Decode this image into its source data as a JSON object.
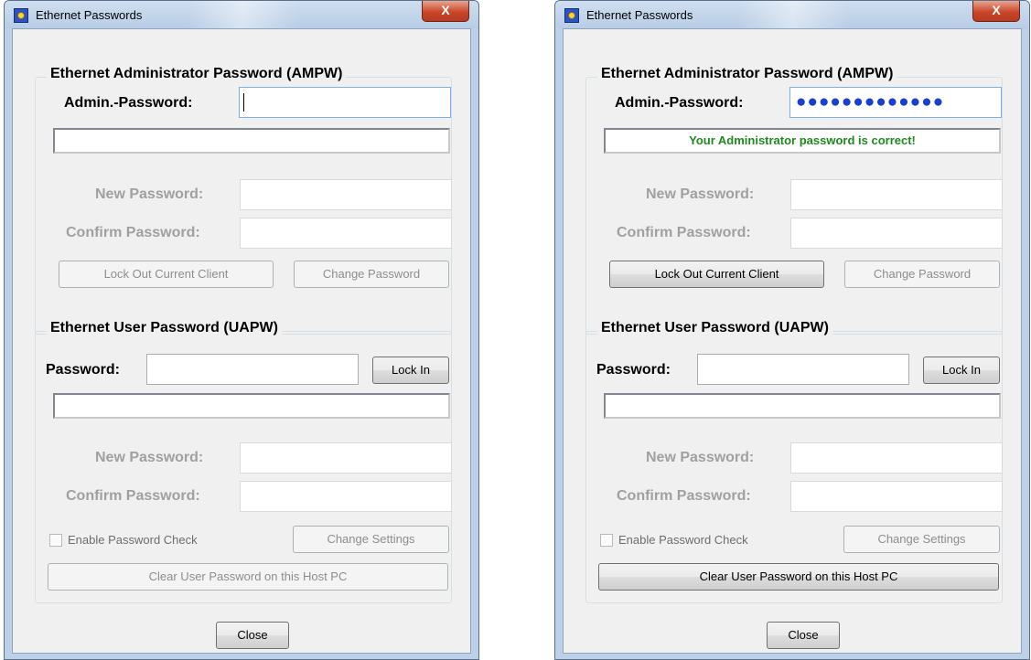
{
  "windows": [
    {
      "title": "Ethernet Passwords",
      "close_glyph": "X",
      "ampw": {
        "group_title": "Ethernet Administrator Password (AMPW)",
        "admin_label": "Admin.-Password:",
        "admin_value": "",
        "status_message": "",
        "new_password_label": "New Password:",
        "confirm_password_label": "Confirm Password:",
        "lock_out_button": "Lock Out Current Client",
        "change_password_button": "Change Password"
      },
      "uapw": {
        "group_title": "Ethernet User Password (UAPW)",
        "password_label": "Password:",
        "lock_in_button": "Lock In",
        "status_message": "",
        "new_password_label": "New Password:",
        "confirm_password_label": "Confirm Password:",
        "enable_check_label": "Enable Password Check",
        "enable_check_checked": false,
        "change_settings_button": "Change Settings",
        "clear_button": "Clear User Password on this Host PC"
      },
      "close_button": "Close"
    },
    {
      "title": "Ethernet Passwords",
      "close_glyph": "X",
      "ampw": {
        "group_title": "Ethernet Administrator Password (AMPW)",
        "admin_label": "Admin.-Password:",
        "admin_value": "●●●●●●●●●●●●●",
        "status_message": "Your Administrator password is correct!",
        "new_password_label": "New Password:",
        "confirm_password_label": "Confirm Password:",
        "lock_out_button": "Lock Out Current Client",
        "change_password_button": "Change Password"
      },
      "uapw": {
        "group_title": "Ethernet User Password (UAPW)",
        "password_label": "Password:",
        "lock_in_button": "Lock In",
        "status_message": "",
        "new_password_label": "New Password:",
        "confirm_password_label": "Confirm Password:",
        "enable_check_label": "Enable Password Check",
        "enable_check_checked": false,
        "change_settings_button": "Change Settings",
        "clear_button": "Clear User Password on this Host PC"
      },
      "close_button": "Close"
    }
  ],
  "colors": {
    "success_text": "#1e8a1e",
    "password_dots": "#1a3fd0",
    "disabled_text": "#a0a0a0",
    "close_button_red": "#c9472b"
  },
  "icons": [
    "app-icon",
    "close-icon"
  ]
}
